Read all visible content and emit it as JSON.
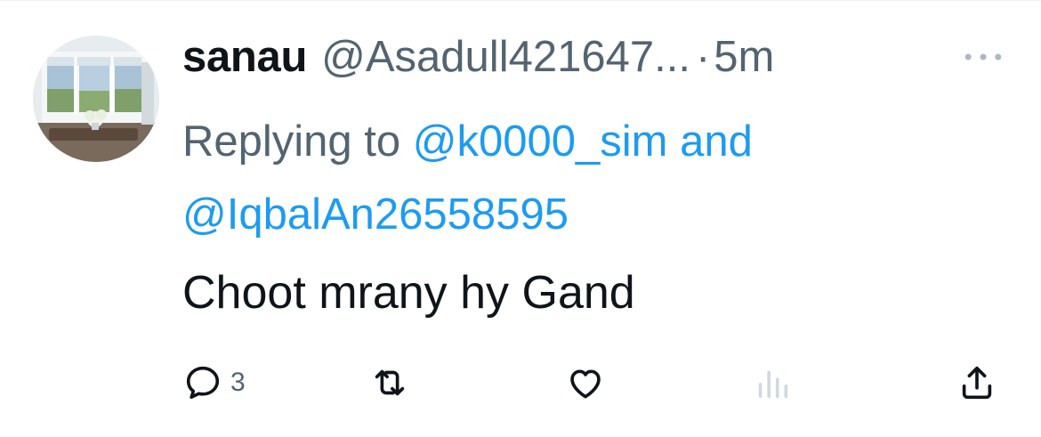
{
  "tweet": {
    "display_name": "sanau",
    "handle": "@Asadull421647...",
    "separator": "·",
    "time": "5m",
    "reply": {
      "prefix": "Replying to",
      "mention1": "@k0000_sim",
      "conjunction": "and",
      "mention2": "@IqbalAn26558595"
    },
    "text": "Choot mrany hy Gand",
    "counts": {
      "replies": "3"
    }
  },
  "icons": {
    "avatar": "avatar-image",
    "more": "more-horizontal-icon",
    "reply": "reply-icon",
    "retweet": "retweet-icon",
    "like": "heart-icon",
    "views": "views-icon",
    "share": "share-icon"
  },
  "colors": {
    "text_primary": "#0f1419",
    "text_secondary": "#536471",
    "link": "#1d9bf0",
    "views_icon": "#cfd9de"
  }
}
